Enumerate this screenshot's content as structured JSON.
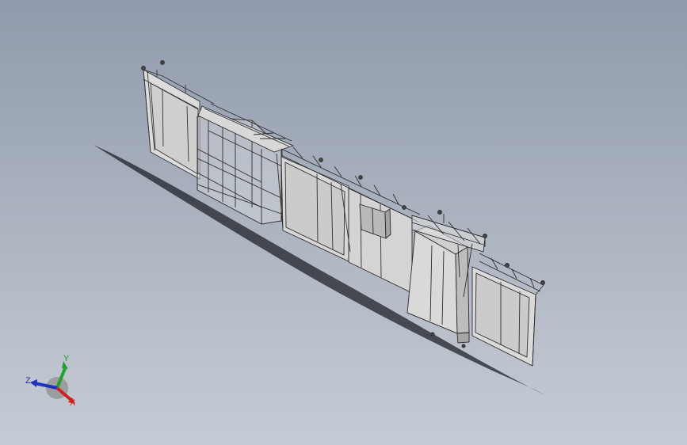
{
  "viewport": {
    "background_top": "#8f9aac",
    "background_bottom": "#c6ccd5",
    "model": "frame-assembly"
  },
  "triad": {
    "x_label": "X",
    "y_label": "Y",
    "z_label": "Z",
    "x_color": "#d12020",
    "y_color": "#22a030",
    "z_color": "#2030c0"
  }
}
